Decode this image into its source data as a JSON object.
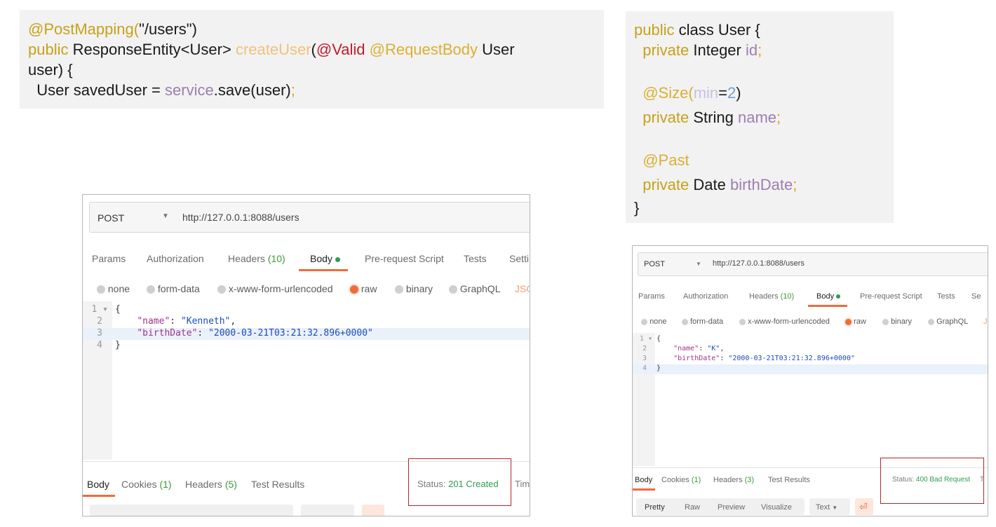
{
  "slide_left_code": {
    "line1_ann": "@PostMapping(",
    "line1_str": "\"/users\"",
    "line1_end": ")",
    "line2_kw": "public",
    "line2_type": " ResponseEntity<User> ",
    "line2_meth": "createUser",
    "line2_paren": "(",
    "line2_valid": "@Valid",
    "line2_rb": " @RequestBody",
    "line2_user": " User",
    "line3": "user) {",
    "line4_pre": "  User savedUser = ",
    "line4_svc": "service",
    "line4_post": ".save(user)",
    "line4_semi": ";"
  },
  "slide_right_code": {
    "l1_kw": "public",
    "l1_rest": " class User {",
    "l2_kw": "  private",
    "l2_type": " Integer ",
    "l2_field": "id",
    "l2_semi": ";",
    "l4_ann": "  @Size(",
    "l4_min": "min",
    "l4_eq": "=",
    "l4_num": "2",
    "l4_end": ")",
    "l5_kw": "  private",
    "l5_type": " String ",
    "l5_field": "name",
    "l5_semi": ";",
    "l7_ann": "  @Past",
    "l8_kw": "  private",
    "l8_type": " Date ",
    "l8_field": "birthDate",
    "l8_semi": ";",
    "l9": "}"
  },
  "postman_left": {
    "method": "POST",
    "url": "http://127.0.0.1:8088/users",
    "tabs": {
      "params": "Params",
      "authorization": "Authorization",
      "headers": "Headers",
      "headers_count": "(10)",
      "body": "Body",
      "prerequest": "Pre-request Script",
      "tests": "Tests",
      "settings": "Setti"
    },
    "body_modes": [
      "none",
      "form-data",
      "x-www-form-urlencoded",
      "raw",
      "binary",
      "GraphQL",
      "JSO"
    ],
    "line_numbers": [
      "1",
      "2",
      "3",
      "4"
    ],
    "code": {
      "l1": "{",
      "l2_key": "\"name\"",
      "l2_val": "\"Kenneth\"",
      "l3_key": "\"birthDate\"",
      "l3_val": "\"2000-03-21T03:21:32.896+0000\"",
      "l4": "}"
    },
    "response_tabs": {
      "body": "Body",
      "cookies": "Cookies",
      "cookies_count": "(1)",
      "headers": "Headers",
      "headers_count": "(5)",
      "test_results": "Test Results"
    },
    "status_label": "Status:",
    "status_value": "201 Created",
    "time_label": "Time:"
  },
  "postman_right": {
    "method": "POST",
    "url": "http://127.0.0.1:8088/users",
    "tabs": {
      "params": "Params",
      "authorization": "Authorization",
      "headers": "Headers",
      "headers_count": "(10)",
      "body": "Body",
      "prerequest": "Pre-request Script",
      "tests": "Tests",
      "settings": "Se"
    },
    "body_modes": [
      "none",
      "form-data",
      "x-www-form-urlencoded",
      "raw",
      "binary",
      "GraphQL",
      "J"
    ],
    "line_numbers": [
      "1",
      "2",
      "3",
      "4"
    ],
    "code": {
      "l1": "{",
      "l2_key": "\"name\"",
      "l2_val": "\"K\"",
      "l3_key": "\"birthDate\"",
      "l3_val": "\"2000-03-21T03:21:32.896+0000\"",
      "l4": "}"
    },
    "response_tabs": {
      "body": "Body",
      "cookies": "Cookies",
      "cookies_count": "(1)",
      "headers": "Headers",
      "headers_count": "(3)",
      "test_results": "Test Results"
    },
    "status_label": "Status:",
    "status_value": "400 Bad Request",
    "time_label": "T",
    "view_buttons": [
      "Pretty",
      "Raw",
      "Preview",
      "Visualize"
    ],
    "format_select": "Text"
  },
  "colors": {
    "accent_orange": "#f26b3a",
    "status_green": "#2f9c4e",
    "highlight_red": "#b3262b"
  }
}
